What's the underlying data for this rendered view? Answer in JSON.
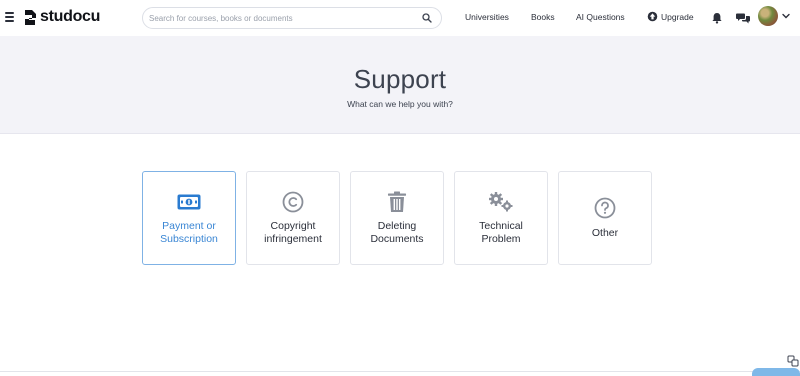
{
  "header": {
    "logo_text": "studocu",
    "search": {
      "placeholder": "Search for courses, books or documents"
    },
    "nav": {
      "universities": "Universities",
      "books": "Books",
      "ai_questions": "AI Questions",
      "upgrade": "Upgrade"
    },
    "icons": [
      "hamburger-icon",
      "search-icon",
      "upgrade-icon",
      "bell-icon",
      "chat-icon",
      "chevron-down-icon"
    ]
  },
  "hero": {
    "title": "Support",
    "subtitle": "What can we help you with?"
  },
  "categories": [
    {
      "label": "Payment or Subscription",
      "icon": "money-bill-icon",
      "selected": true
    },
    {
      "label": "Copyright infringement",
      "icon": "copyright-icon",
      "selected": false
    },
    {
      "label": "Deleting Documents",
      "icon": "trash-icon",
      "selected": false
    },
    {
      "label": "Technical Problem",
      "icon": "gears-icon",
      "selected": false
    },
    {
      "label": "Other",
      "icon": "question-icon",
      "selected": false
    }
  ],
  "colors": {
    "accent": "#3a86d4",
    "accent_border": "#7fb2e5",
    "hero_bg": "#f3f3f8",
    "text": "#2b2f3a",
    "icon_gray": "#8a8f99"
  }
}
